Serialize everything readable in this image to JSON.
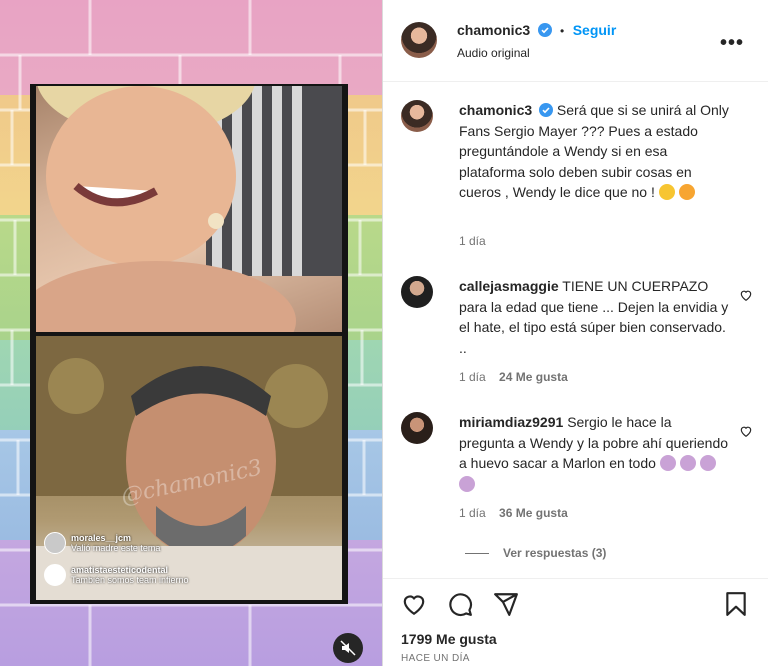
{
  "header": {
    "username": "chamonic3",
    "follow_label": "Seguir",
    "separator": "•",
    "audio": "Audio original",
    "more": "•••"
  },
  "caption": {
    "username": "chamonic3",
    "text": "Será que si se unirá al Only Fans Sergio Mayer ??? Pues a estado preguntándole a Wendy si en esa plataforma solo deben subir cosas en cueros , Wendy le dice que no !",
    "time": "1 día"
  },
  "comments": [
    {
      "username": "callejasmaggie",
      "text": "TIENE UN CUERPAZO para la edad que tiene ... Dejen la envidia y el hate, el tipo está súper bien conservado. ..",
      "time": "1 día",
      "likes": "24 Me gusta"
    },
    {
      "username": "miriamdiaz9291",
      "text": "Sergio le hace la pregunta a Wendy y la pobre ahí queriendo a huevo sacar a Marlon en todo",
      "time": "1 día",
      "likes": "36 Me gusta"
    }
  ],
  "view_replies": "Ver respuestas (3)",
  "likes_count": "1799 Me gusta",
  "posted_ago": "HACE UN DÍA",
  "media": {
    "live_comments": [
      {
        "user": "morales__jcm",
        "text": "Valió madre este tema"
      },
      {
        "user": "amatistaesteticodental",
        "text": "También somos team infierno"
      }
    ],
    "watermark": "@chamonic3"
  },
  "colors": {
    "accent": "#0095f6",
    "verified": "#3897f0"
  }
}
